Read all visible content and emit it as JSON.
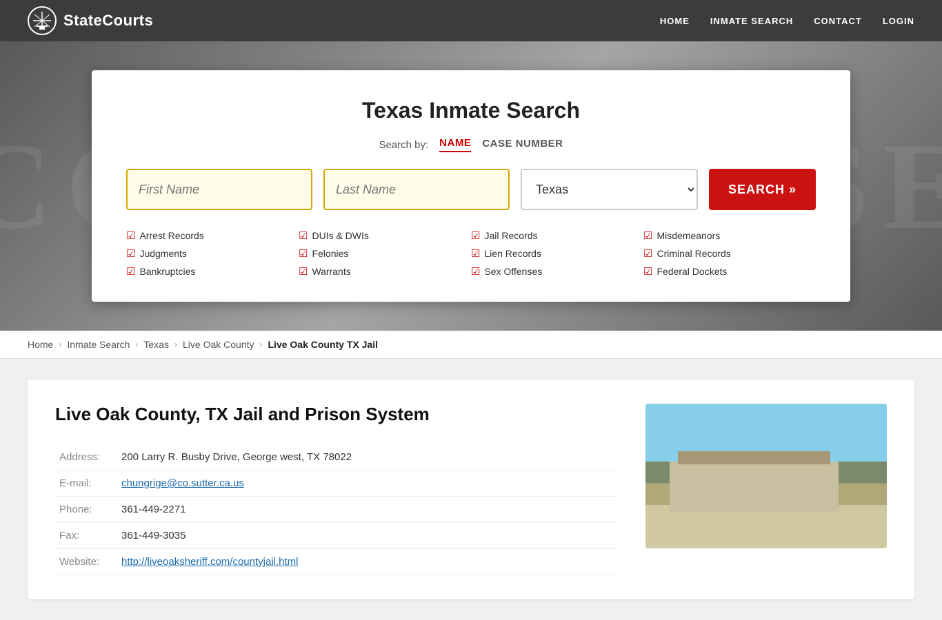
{
  "site": {
    "name": "StateCourts"
  },
  "nav": {
    "links": [
      {
        "label": "HOME",
        "href": "#"
      },
      {
        "label": "INMATE SEARCH",
        "href": "#"
      },
      {
        "label": "CONTACT",
        "href": "#"
      },
      {
        "label": "LOGIN",
        "href": "#"
      }
    ]
  },
  "hero_bg_text": "COURTHOUSE",
  "search_card": {
    "title": "Texas Inmate Search",
    "search_by_label": "Search by:",
    "tab_name": "NAME",
    "tab_case": "CASE NUMBER",
    "first_name_placeholder": "First Name",
    "last_name_placeholder": "Last Name",
    "state_value": "Texas",
    "search_button_label": "SEARCH »",
    "checklist": [
      {
        "items": [
          "Arrest Records",
          "Judgments",
          "Bankruptcies"
        ]
      },
      {
        "items": [
          "DUIs & DWIs",
          "Felonies",
          "Warrants"
        ]
      },
      {
        "items": [
          "Jail Records",
          "Lien Records",
          "Sex Offenses"
        ]
      },
      {
        "items": [
          "Misdemeanors",
          "Criminal Records",
          "Federal Dockets"
        ]
      }
    ]
  },
  "breadcrumb": {
    "home": "Home",
    "inmate_search": "Inmate Search",
    "texas": "Texas",
    "live_oak_county": "Live Oak County",
    "current": "Live Oak County TX Jail"
  },
  "content": {
    "title": "Live Oak County, TX Jail and Prison System",
    "address_label": "Address:",
    "address_value": "200 Larry R. Busby Drive, George west, TX 78022",
    "email_label": "E-mail:",
    "email_value": "chungrige@co.sutter.ca.us",
    "phone_label": "Phone:",
    "phone_value": "361-449-2271",
    "fax_label": "Fax:",
    "fax_value": "361-449-3035",
    "website_label": "Website:",
    "website_value": "http://liveoaksheriff.com/countyjail.html"
  }
}
